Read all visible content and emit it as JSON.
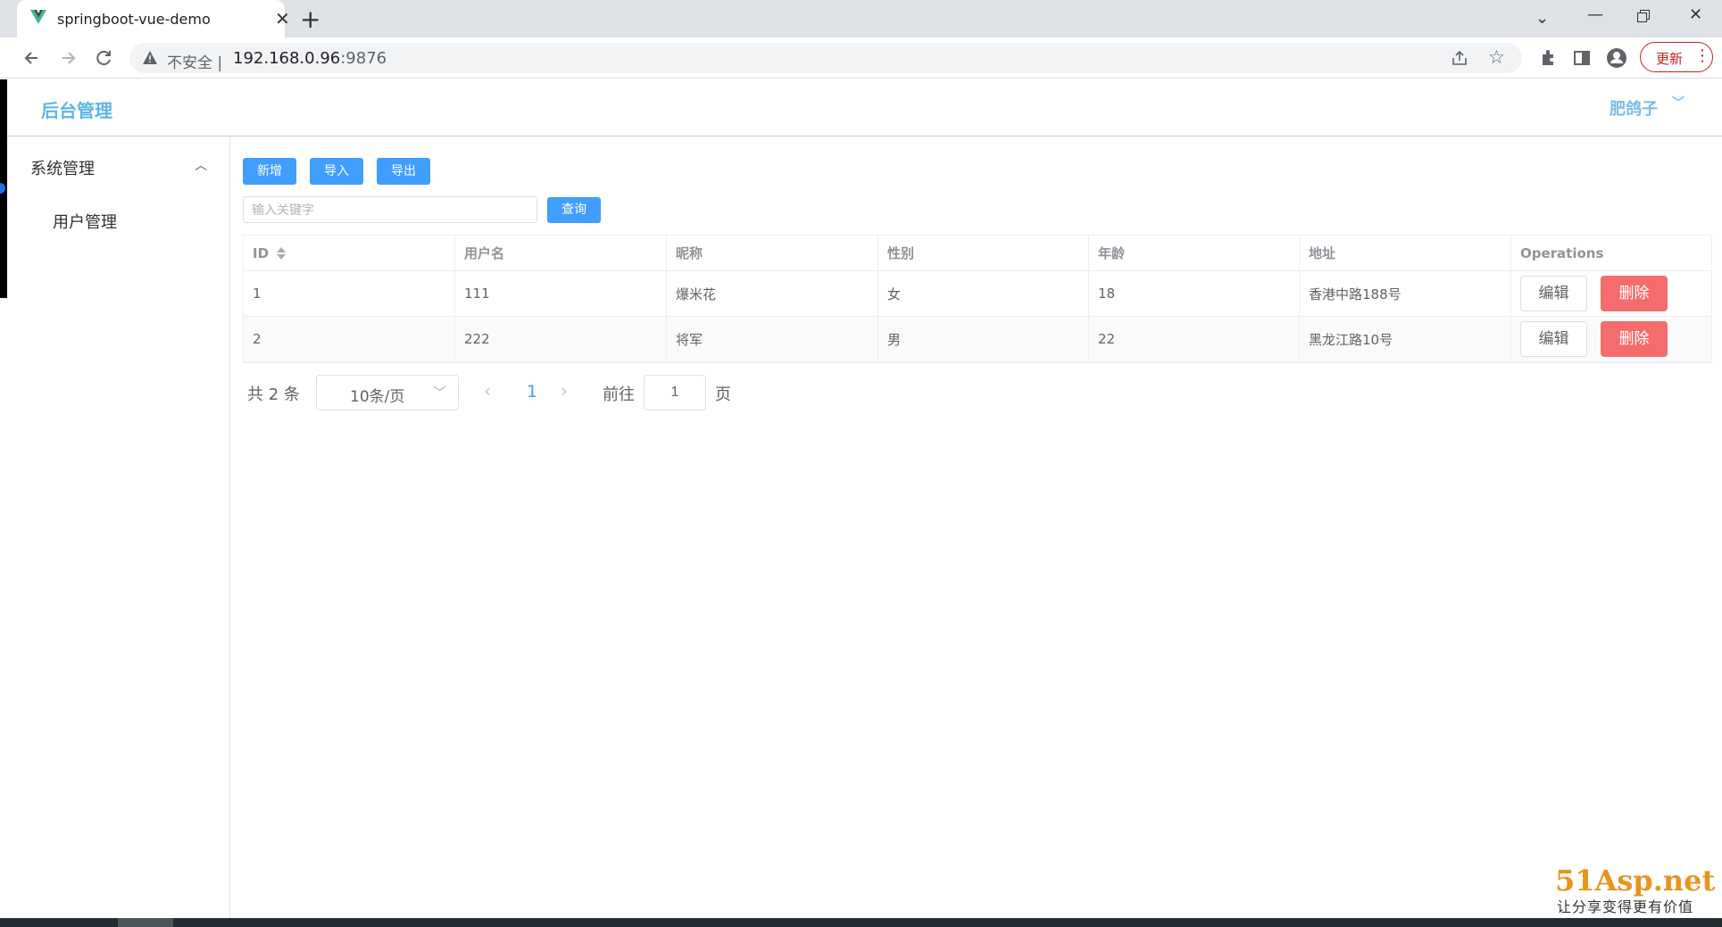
{
  "browser": {
    "tab_title": "springboot-vue-demo",
    "security_label": "不安全 |",
    "url_host": "192.168.0.96",
    "url_port": ":9876",
    "update_label": "更新"
  },
  "header": {
    "brand": "后台管理",
    "user_name": "肥鸽子"
  },
  "sidebar": {
    "group_label": "系统管理",
    "items": [
      {
        "label": "用户管理"
      }
    ]
  },
  "toolbar": {
    "add_label": "新增",
    "import_label": "导入",
    "export_label": "导出",
    "search_placeholder": "输入关键字",
    "search_label": "查询"
  },
  "table": {
    "columns": [
      "ID",
      "用户名",
      "昵称",
      "性别",
      "年龄",
      "地址",
      "Operations"
    ],
    "rows": [
      {
        "id": "1",
        "username": "111",
        "nickname": "爆米花",
        "gender": "女",
        "age": "18",
        "address": "香港中路188号"
      },
      {
        "id": "2",
        "username": "222",
        "nickname": "将军",
        "gender": "男",
        "age": "22",
        "address": "黑龙江路10号"
      }
    ],
    "edit_label": "编辑",
    "delete_label": "删除"
  },
  "pagination": {
    "total_text": "共 2 条",
    "page_size": "10条/页",
    "current_page": "1",
    "goto_label": "前往",
    "jump_value": "1",
    "page_suffix": "页"
  },
  "watermark": {
    "logo": "51Asp.net",
    "tagline": "让分享变得更有价值"
  },
  "colors": {
    "primary": "#409eff",
    "danger": "#f56c6c",
    "brand_text": "#5fb4e8"
  }
}
